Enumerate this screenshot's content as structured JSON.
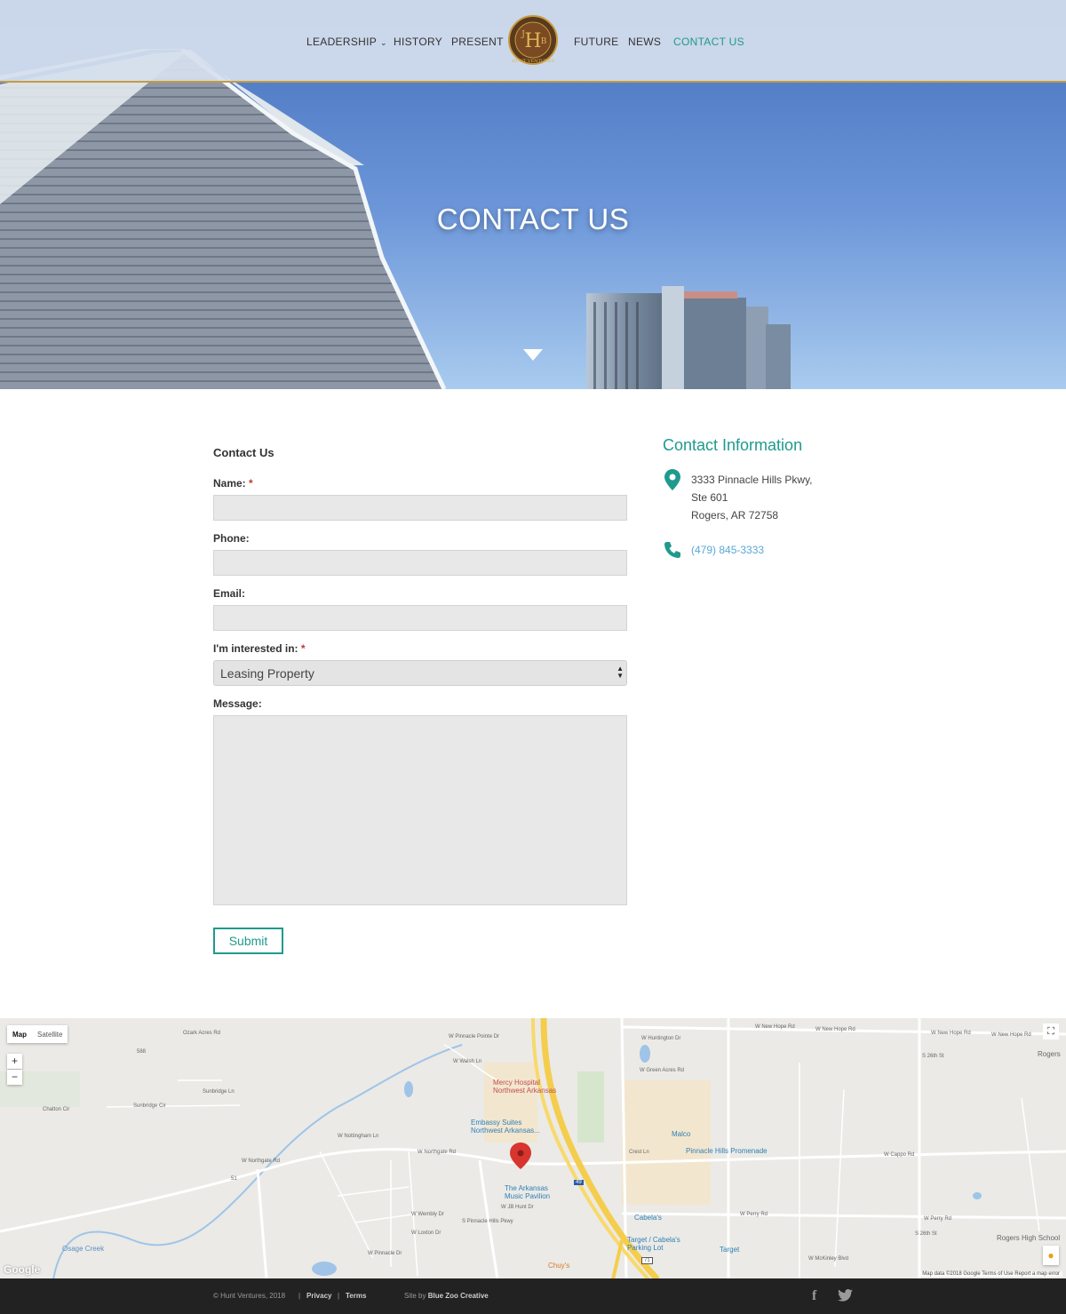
{
  "nav": {
    "items": [
      {
        "label": "LEADERSHIP",
        "has_caret": true
      },
      {
        "label": "HISTORY"
      },
      {
        "label": "PRESENT"
      },
      {
        "label": "FUTURE"
      },
      {
        "label": "NEWS"
      },
      {
        "label": "CONTACT US",
        "active": true
      }
    ],
    "caret": "⌄",
    "logo": {
      "initials_left": "J",
      "initials_center": "H",
      "initials_right": "B",
      "ring_text": "HUNT VENTURES"
    }
  },
  "hero": {
    "title": "CONTACT US"
  },
  "form": {
    "title": "Contact Us",
    "name_label": "Name:",
    "phone_label": "Phone:",
    "email_label": "Email:",
    "interest_label": "I'm interested in:",
    "interest_value": "Leasing Property",
    "message_label": "Message:",
    "required_mark": "*",
    "submit_label": "Submit"
  },
  "contact_info": {
    "title": "Contact Information",
    "address_line1": "3333 Pinnacle Hills Pkwy,",
    "address_line2": "Ste 601",
    "address_line3": "Rogers, AR 72758",
    "phone": "(479) 845-3333"
  },
  "map": {
    "type_map": "Map",
    "type_satellite": "Satellite",
    "zoom_in": "+",
    "zoom_out": "−",
    "fullscreen": "⛶",
    "credits": "Map data ©2018 Google    Terms of Use    Report a map error",
    "google": "Google",
    "labels": {
      "ozark_acres": "Ozark Acres Rd",
      "r588": "588",
      "sunbridge_ln": "Sunbridge Ln",
      "sunbridge_cir": "Sunbridge Cir",
      "chatton": "Chatton Cir",
      "nottingham": "W Nottingham Ln",
      "northgate": "W Northgate Rd",
      "northgate2": "W Northgate Rd",
      "r51": "51",
      "osage": "Osage Creek",
      "pinnacle_pointe": "W Pinnacle Pointe Dr",
      "walsh": "W Walsh Ln",
      "pinnacle_pkwy": "S Pinnacle Hills Pkwy",
      "jb_hunt": "W JB Hunt Dr",
      "huntington": "W Huntington Dr",
      "green_acres": "W Green Acres Rd",
      "new_hope1": "W New Hope Rd",
      "new_hope2": "W New Hope Rd",
      "new_hope3": "W New Hope Rd",
      "new_hope4": "W New Hope Rd",
      "s26": "S 26th St",
      "s26b": "S 26th St",
      "cappo": "W Cappo Rd",
      "perry": "W Perry Rd",
      "perry2": "W Perry Rd",
      "crest": "Crest Ln",
      "i49": "49",
      "r71": "71",
      "rogers": "Rogers",
      "wembly": "W Wembly Dr",
      "loxton": "W Loxton Dr",
      "pinnacle_dr": "W Pinnacle Dr",
      "mckinley": "W McKinley Blvd"
    },
    "pois": {
      "mercy": "Mercy Hospital\nNorthwest Arkansas",
      "embassy": "Embassy Suites\nNorthwest Arkansas...",
      "pavilion": "The Arkansas\nMusic Pavilion",
      "malco": "Malco",
      "promenade": "Pinnacle Hills Promenade",
      "cabelas": "Cabela's",
      "target_cabelas": "Target / Cabela's\nParking Lot",
      "target": "Target",
      "chuys": "Chuy's",
      "rogers_high": "Rogers High School"
    }
  },
  "footer": {
    "copyright": "© Hunt Ventures, 2018",
    "sep": "|",
    "privacy": "Privacy",
    "terms": "Terms",
    "site_by": "Site by",
    "agency": "Blue Zoo Creative",
    "facebook": "f",
    "twitter": "🐦"
  },
  "colors": {
    "accent": "#1f9a8d",
    "gold": "#c79a3e",
    "footer_bg": "#222222",
    "link": "#5aa7d8"
  }
}
